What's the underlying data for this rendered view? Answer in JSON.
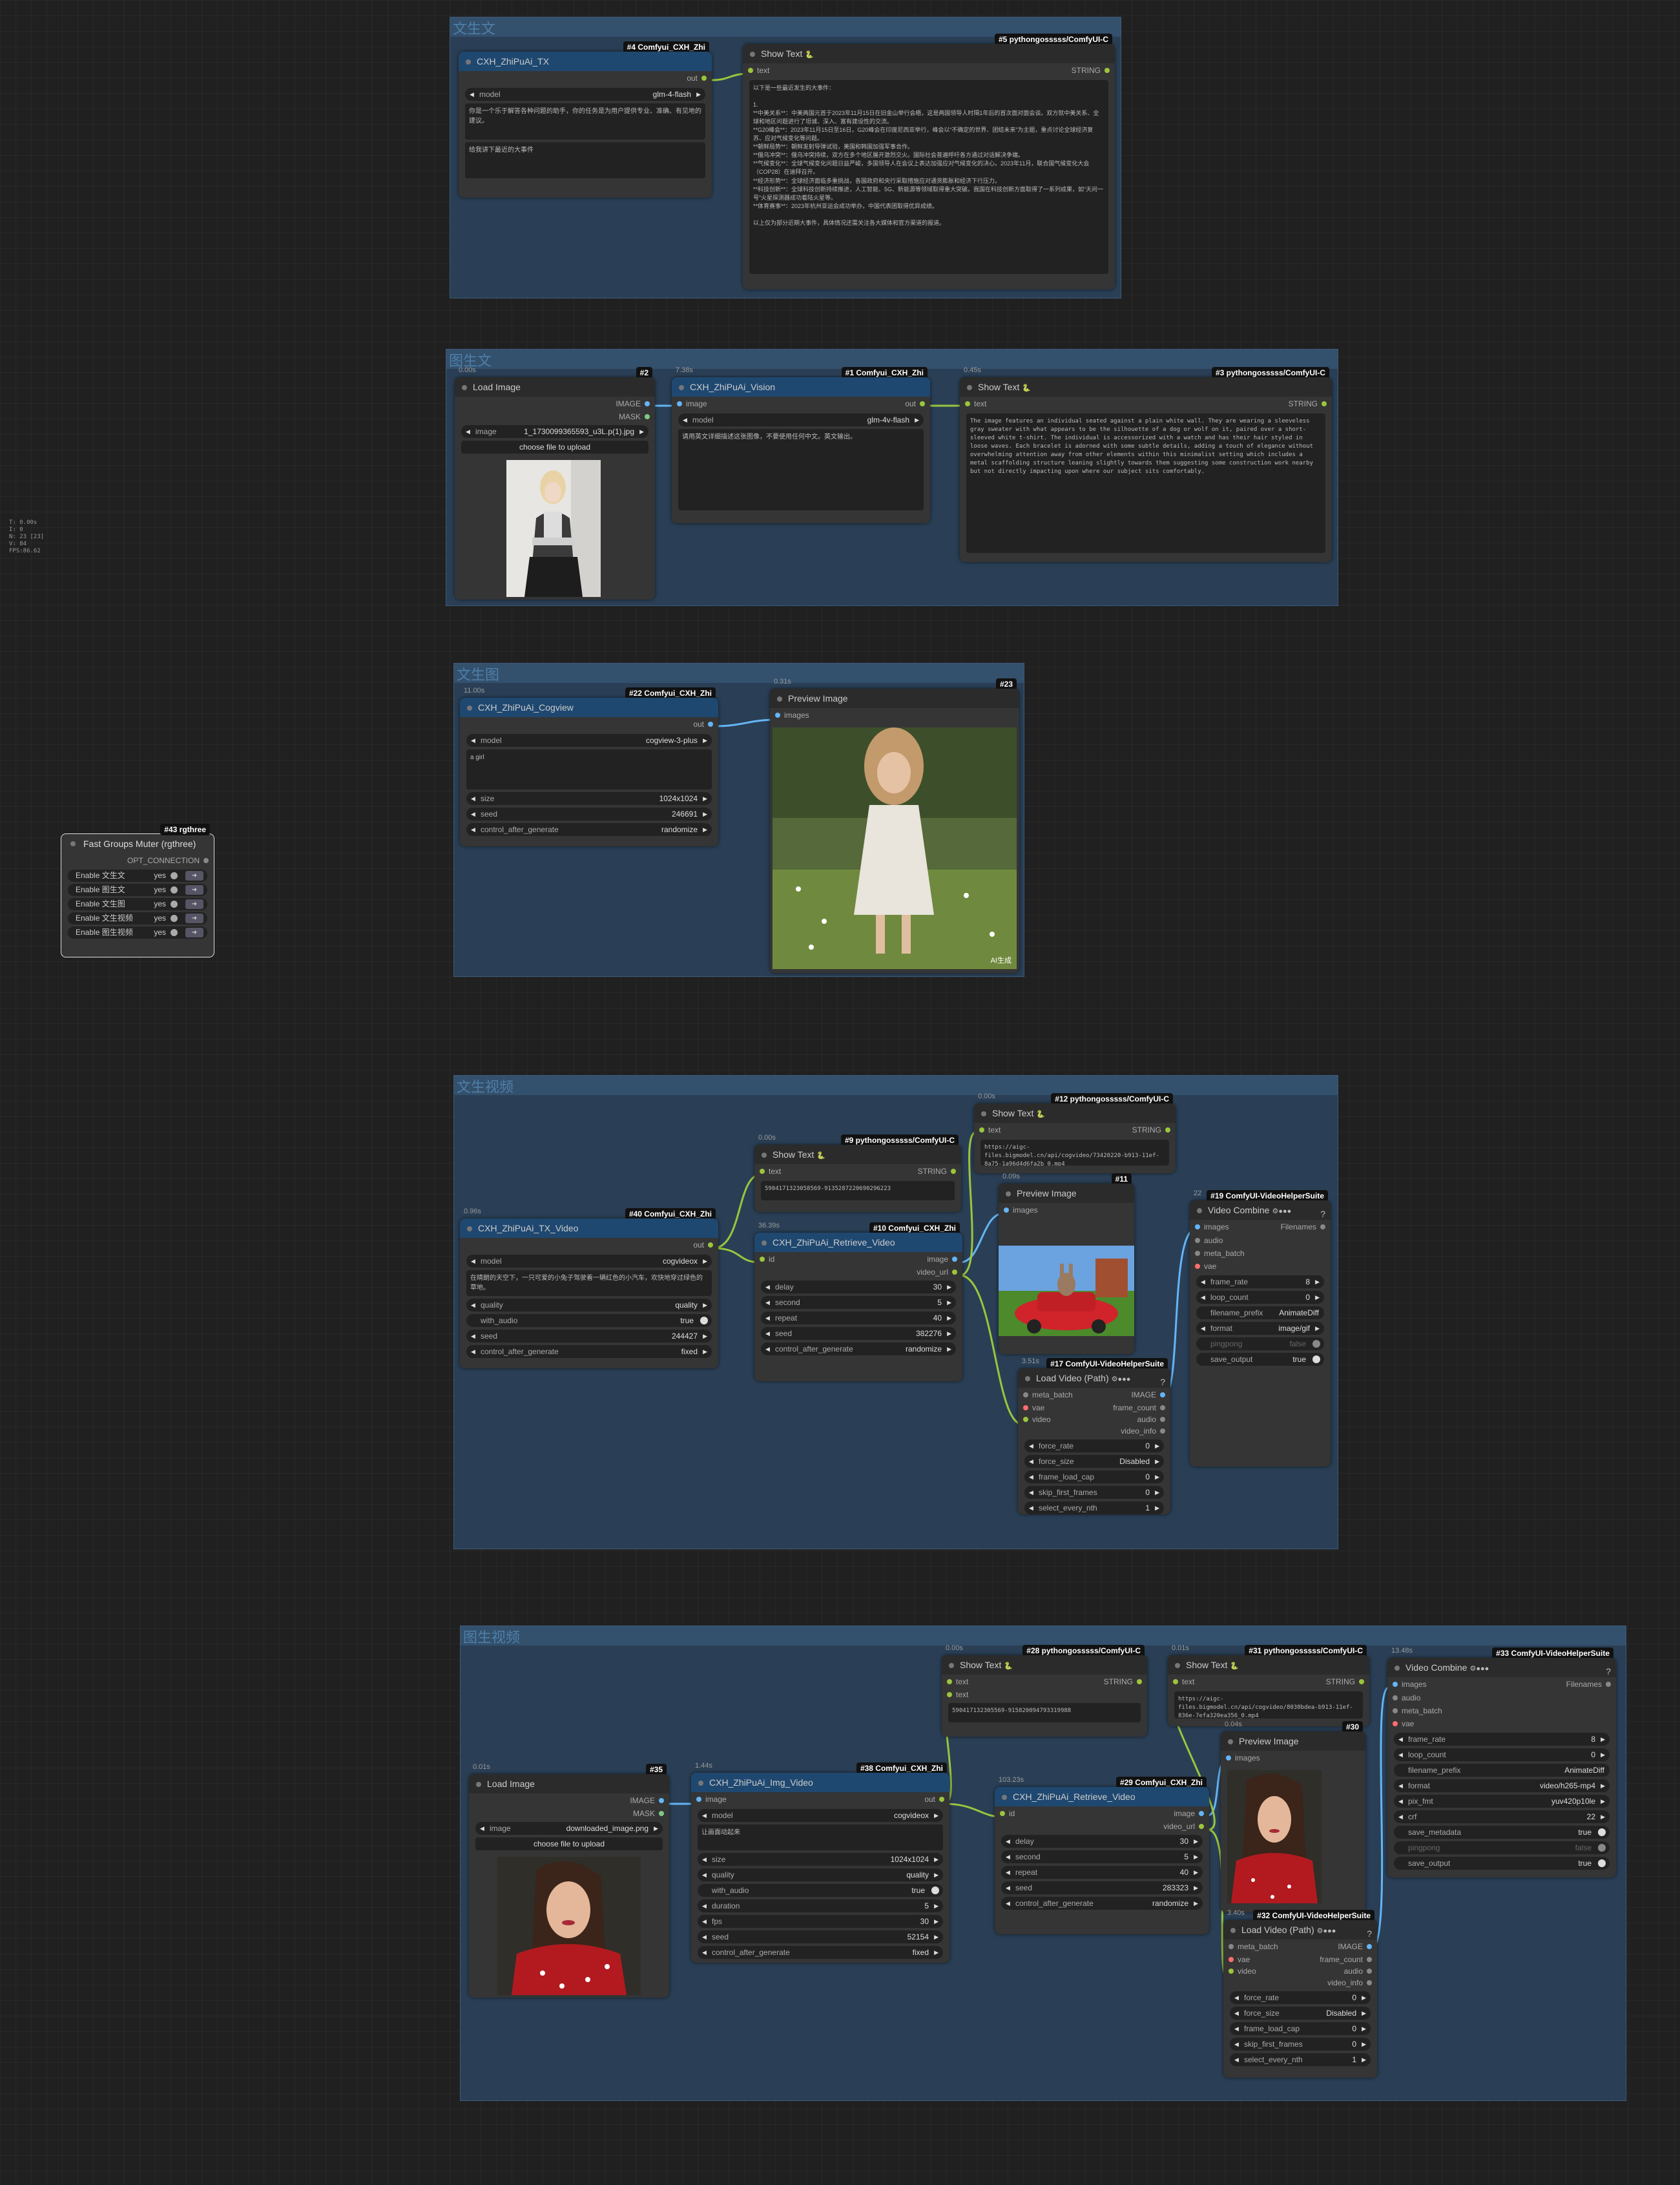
{
  "stats": {
    "t": "T: 0.00s",
    "i": "I: 0",
    "n": "N: 23 [23]",
    "v": "V: 84",
    "fps": "FPS:86.62"
  },
  "groups": {
    "g1": "文生文",
    "g2": "图生文",
    "g3": "文生图",
    "g4": "文生视频",
    "g5": "图生视频"
  },
  "muter": {
    "badge": "#43 rgthree",
    "title": "Fast Groups Muter (rgthree)",
    "opt": "OPT_CONNECTION",
    "rows": [
      {
        "label": "Enable 文生文",
        "value": "yes"
      },
      {
        "label": "Enable 图生文",
        "value": "yes"
      },
      {
        "label": "Enable 文生图",
        "value": "yes"
      },
      {
        "label": "Enable 文生视频",
        "value": "yes"
      },
      {
        "label": "Enable 图生视频",
        "value": "yes"
      }
    ]
  },
  "n4": {
    "badge": "#4 Comfyui_CXH_Zhi",
    "title": "CXH_ZhiPuAi_TX",
    "out": "out",
    "model_k": "model",
    "model_v": "glm-4-flash",
    "sys": "你是一个乐于解答各种问题的助手，你的任务是为用户提供专业、准确、有见地的建议。",
    "prompt": "给我讲下最近的大事件"
  },
  "n5": {
    "badge": "#5 pythongosssss/ComfyUI-C",
    "title": "Show Text",
    "in": "text",
    "out": "STRING",
    "text": "以下是一些最近发生的大事件：\n\n1.\n**中美关系**：中美两国元首于2023年11月15日在旧金山举行会晤，这是两国领导人时隔1年后的首次面对面会谈。双方就中美关系、全球和地区问题进行了坦诚、深入、富有建设性的交流。\n**G20峰会**：2023年11月15日至16日，G20峰会在印度尼西亚举行，峰会以“不确定的世界、团结未来”为主题，重点讨论全球经济复苏、应对气候变化等问题。\n**朝鲜局势**：朝鲜发射导弹试验，美国和韩国加强军事合作。\n**俄乌冲突**：俄乌冲突持续，双方在多个地区展开激烈交火。国际社会普遍呼吁各方通过对话解决争端。\n**气候变化**：全球气候变化问题日益严峻，多国领导人在会议上表达加强应对气候变化的决心。2023年11月，联合国气候变化大会（COP28）在迪拜召开。\n**经济形势**：全球经济面临多重挑战，各国政府和央行采取措施应对通货膨胀和经济下行压力。\n**科技创新**：全球科技创新持续推进，人工智能、5G、新能源等领域取得重大突破。我国在科技创新方面取得了一系列成果，如“天问一号”火星探测器成功着陆火星等。\n**体育赛事**：2023年杭州亚运会成功举办，中国代表团取得优异成绩。\n\n以上仅为部分近期大事件，具体情况还需关注各大媒体和官方渠道的报道。"
  },
  "n2": {
    "time": "0.00s",
    "badge": "#2",
    "title": "Load Image",
    "out1": "IMAGE",
    "out2": "MASK",
    "img_k": "image",
    "img_v": "1_1730099365593_u3L.p(1).jpg",
    "upload": "choose file to upload"
  },
  "n1": {
    "time": "7.38s",
    "badge": "#1 Comfyui_CXH_Zhi",
    "title": "CXH_ZhiPuAi_Vision",
    "in": "image",
    "out": "out",
    "model_k": "model",
    "model_v": "glm-4v-flash",
    "prompt": "请用英文详细描述这张图像，不要使用任何中文。英文输出。"
  },
  "n3": {
    "time": "0.45s",
    "badge": "#3 pythongosssss/ComfyUI-C",
    "title": "Show Text",
    "in": "text",
    "out": "STRING",
    "text": "The image features an individual seated against a plain white wall. They are wearing a sleeveless gray sweater with what appears to be the silhouette of a dog or wolf on it, paired over a short-sleeved white t-shirt. The individual is accessorized with a watch and has their hair styled in loose waves. Each bracelet is adorned with some subtle details, adding a touch of elegance without overwhelming attention away from other elements within this minimalist setting which includes a metal scaffolding structure leaning slightly towards them suggesting some construction work nearby but not directly impacting upon where our subject sits comfortably."
  },
  "n22": {
    "time": "11.00s",
    "badge": "#22 Comfyui_CXH_Zhi",
    "title": "CXH_ZhiPuAi_Cogview",
    "out": "out",
    "model_k": "model",
    "model_v": "cogview-3-plus",
    "prompt": "a girl",
    "w": [
      {
        "k": "size",
        "v": "1024x1024"
      },
      {
        "k": "seed",
        "v": "246691"
      },
      {
        "k": "control_after_generate",
        "v": "randomize"
      }
    ]
  },
  "n23": {
    "time": "0.31s",
    "badge": "#23",
    "title": "Preview Image",
    "in": "images",
    "watermark": "AI生成"
  },
  "n40": {
    "time": "0.96s",
    "badge": "#40 Comfyui_CXH_Zhi",
    "title": "CXH_ZhiPuAi_TX_Video",
    "out": "out",
    "model_k": "model",
    "model_v": "cogvideox",
    "prompt": "在晴朗的天空下，一只可爱的小兔子驾驶着一辆红色的小汽车，欢快地穿过绿色的草地。",
    "w": [
      {
        "k": "quality",
        "v": "quality"
      },
      {
        "k": "seed",
        "v": "244427"
      },
      {
        "k": "control_after_generate",
        "v": "fixed"
      }
    ],
    "audio_k": "with_audio",
    "audio_v": "true"
  },
  "n9": {
    "time": "0.00s",
    "badge": "#9 pythongosssss/ComfyUI-C",
    "title": "Show Text",
    "in": "text",
    "out": "STRING",
    "text": "590417132305856​9-9135287220690296223"
  },
  "n10": {
    "time": "36.39s",
    "badge": "#10 Comfyui_CXH_Zhi",
    "title": "CXH_ZhiPuAi_Retrieve_Video",
    "in": "id",
    "out1": "image",
    "out2": "video_url",
    "w": [
      {
        "k": "delay",
        "v": "30"
      },
      {
        "k": "second",
        "v": "5"
      },
      {
        "k": "repeat",
        "v": "40"
      },
      {
        "k": "seed",
        "v": "382276"
      },
      {
        "k": "control_after_generate",
        "v": "randomize"
      }
    ]
  },
  "n12": {
    "time": "0.00s",
    "badge": "#12 pythongosssss/ComfyUI-C",
    "title": "Show Text",
    "in": "text",
    "out": "STRING",
    "text": "https://aigc-files.bigmodel.cn/api/cogvideo/73420220-b913-11ef-8a75-1a96d4d6fa2b_0.mp4"
  },
  "n11": {
    "time": "0.09s",
    "badge": "#11",
    "title": "Preview Image",
    "in": "images"
  },
  "n17": {
    "time": "3.51s",
    "badge": "#17 ComfyUI-VideoHelperSuite",
    "title": "Load Video (Path)",
    "in1": "meta_batch",
    "in2": "vae",
    "in3": "video",
    "out1": "IMAGE",
    "out2": "frame_count",
    "out3": "audio",
    "out4": "video_info",
    "w": [
      {
        "k": "force_rate",
        "v": "0"
      },
      {
        "k": "force_size",
        "v": "Disabled"
      },
      {
        "k": "frame_load_cap",
        "v": "0"
      },
      {
        "k": "skip_first_frames",
        "v": "0"
      },
      {
        "k": "select_every_nth",
        "v": "1"
      }
    ]
  },
  "n19": {
    "time": "22",
    "badge": "#19 ComfyUI-VideoHelperSuite",
    "title": "Video Combine",
    "in1": "images",
    "in2": "audio",
    "in3": "meta_batch",
    "in4": "vae",
    "out": "Filenames",
    "w": [
      {
        "k": "frame_rate",
        "v": "8"
      },
      {
        "k": "loop_count",
        "v": "0"
      },
      {
        "k": "filename_prefix",
        "v": "AnimateDiff"
      },
      {
        "k": "format",
        "v": "image/gif"
      }
    ],
    "t": [
      {
        "k": "pingpong",
        "v": "false"
      },
      {
        "k": "save_output",
        "v": "true"
      }
    ]
  },
  "n35": {
    "time": "0.01s",
    "badge": "#35",
    "title": "Load Image",
    "out1": "IMAGE",
    "out2": "MASK",
    "img_k": "image",
    "img_v": "downloaded_image.png",
    "upload": "choose file to upload"
  },
  "n38": {
    "time": "1.44s",
    "badge": "#38 Comfyui_CXH_Zhi",
    "title": "CXH_ZhiPuAi_Img_Video",
    "in": "image",
    "out": "out",
    "model_k": "model",
    "model_v": "cogvideox",
    "prompt": "让画面动起来",
    "w1": [
      {
        "k": "size",
        "v": "1024x1024"
      },
      {
        "k": "quality",
        "v": "quality"
      }
    ],
    "audio_k": "with_audio",
    "audio_v": "true",
    "w2": [
      {
        "k": "duration",
        "v": "5"
      },
      {
        "k": "fps",
        "v": "30"
      },
      {
        "k": "seed",
        "v": "52154"
      },
      {
        "k": "control_after_generate",
        "v": "fixed"
      }
    ]
  },
  "n28": {
    "time": "0.00s",
    "badge": "#28 pythongosssss/ComfyUI-C",
    "title": "Show Text",
    "in1": "text",
    "in2": "text",
    "out": "STRING",
    "text": "590417132305569-915820094793319988"
  },
  "n29": {
    "time": "103.23s",
    "badge": "#29 Comfyui_CXH_Zhi",
    "title": "CXH_ZhiPuAi_Retrieve_Video",
    "in": "id",
    "out1": "image",
    "out2": "video_url",
    "w": [
      {
        "k": "delay",
        "v": "30"
      },
      {
        "k": "second",
        "v": "5"
      },
      {
        "k": "repeat",
        "v": "40"
      },
      {
        "k": "seed",
        "v": "283323"
      },
      {
        "k": "control_after_generate",
        "v": "randomize"
      }
    ]
  },
  "n31": {
    "time": "0.01s",
    "badge": "#31 pythongosssss/ComfyUI-C",
    "title": "Show Text",
    "in": "text",
    "out": "STRING",
    "text": "https://aigc-files.bigmodel.cn/api/cogvideo/8030bdea-b913-11ef-836e-7efa320ea356_0.mp4"
  },
  "n30": {
    "time": "0.04s",
    "badge": "#30",
    "title": "Preview Image",
    "in": "images"
  },
  "n32": {
    "time": "3.40s",
    "badge": "#32 ComfyUI-VideoHelperSuite",
    "title": "Load Video (Path)",
    "in1": "meta_batch",
    "in2": "vae",
    "in3": "video",
    "out1": "IMAGE",
    "out2": "frame_count",
    "out3": "audio",
    "out4": "video_info",
    "w": [
      {
        "k": "force_rate",
        "v": "0"
      },
      {
        "k": "force_size",
        "v": "Disabled"
      },
      {
        "k": "frame_load_cap",
        "v": "0"
      },
      {
        "k": "skip_first_frames",
        "v": "0"
      },
      {
        "k": "select_every_nth",
        "v": "1"
      }
    ]
  },
  "n33": {
    "time": "13.48s",
    "badge": "#33 ComfyUI-VideoHelperSuite",
    "title": "Video Combine",
    "in1": "images",
    "in2": "audio",
    "in3": "meta_batch",
    "in4": "vae",
    "out": "Filenames",
    "w": [
      {
        "k": "frame_rate",
        "v": "8"
      },
      {
        "k": "loop_count",
        "v": "0"
      },
      {
        "k": "filename_prefix",
        "v": "AnimateDiff"
      },
      {
        "k": "format",
        "v": "video/h265-mp4"
      },
      {
        "k": "pix_fmt",
        "v": "yuv420p10le"
      },
      {
        "k": "crf",
        "v": "22"
      }
    ],
    "t": [
      {
        "k": "save_metadata",
        "v": "true"
      },
      {
        "k": "pingpong",
        "v": "false"
      },
      {
        "k": "save_output",
        "v": "true"
      }
    ]
  }
}
